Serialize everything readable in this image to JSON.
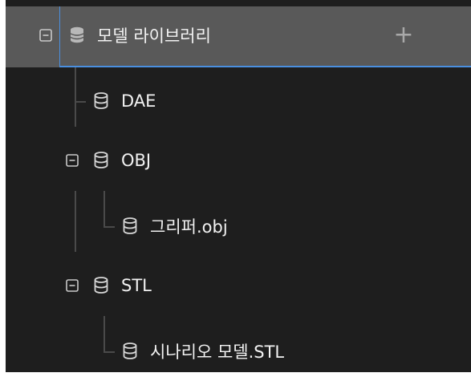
{
  "tree": {
    "root": {
      "label": "모델 라이브러리",
      "add_label": "+"
    },
    "items": [
      {
        "label": "DAE"
      },
      {
        "label": "OBJ",
        "children": [
          {
            "label": "그리퍼.obj"
          }
        ]
      },
      {
        "label": "STL",
        "children": [
          {
            "label": "시나리오 모델.STL"
          }
        ]
      }
    ]
  },
  "colors": {
    "panel_background": "#1e1e1e",
    "header_background": "#595959",
    "selection_border": "#4a8fe0",
    "text": "#f2f2f2",
    "tree_lines": "#4a4a4a"
  },
  "icons": {
    "toggle": "collapse-box-icon",
    "node": "database-icon"
  }
}
